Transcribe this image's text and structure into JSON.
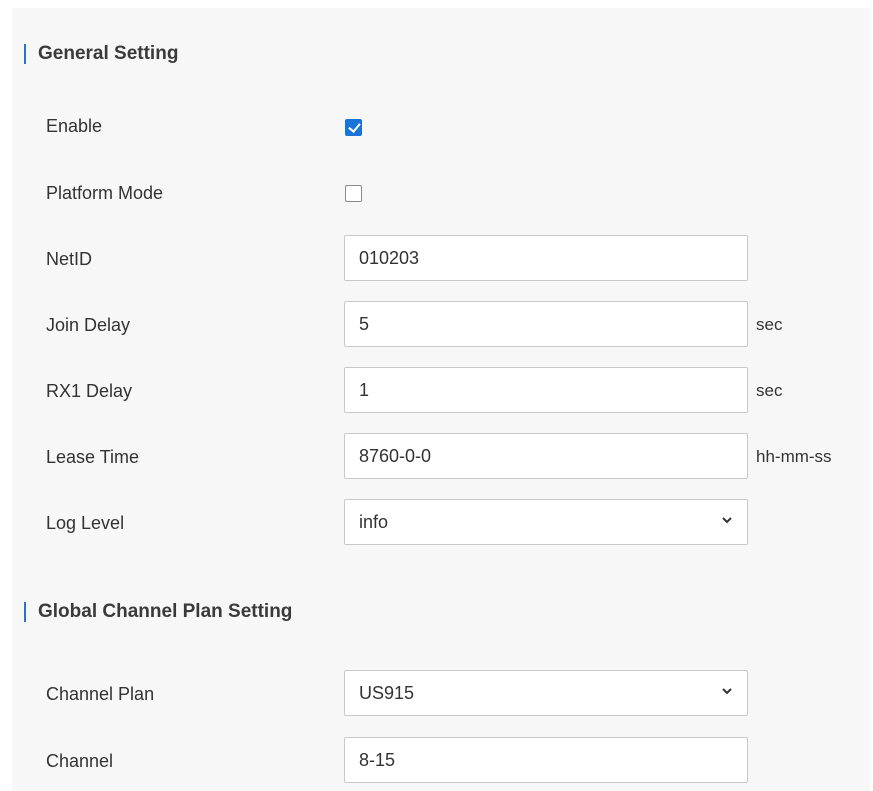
{
  "general": {
    "title": "General Setting",
    "enable": {
      "label": "Enable",
      "checked": true
    },
    "platform_mode": {
      "label": "Platform Mode",
      "checked": false
    },
    "netid": {
      "label": "NetID",
      "value": "010203"
    },
    "join_delay": {
      "label": "Join Delay",
      "value": "5",
      "unit": "sec"
    },
    "rx1_delay": {
      "label": "RX1 Delay",
      "value": "1",
      "unit": "sec"
    },
    "lease_time": {
      "label": "Lease Time",
      "value": "8760-0-0",
      "unit": "hh-mm-ss"
    },
    "log_level": {
      "label": "Log Level",
      "selected": "info"
    }
  },
  "channel_plan": {
    "title": "Global Channel Plan Setting",
    "plan": {
      "label": "Channel Plan",
      "selected": "US915"
    },
    "channel": {
      "label": "Channel",
      "value": "8-15"
    }
  },
  "colors": {
    "accent": "#1a73d9",
    "section_bar": "#2b74c9",
    "panel_bg": "#f7f7f7",
    "field_border": "#c9c9c9"
  },
  "icons": {
    "dropdown": "chevron-down-icon",
    "checked": "checkmark-icon"
  }
}
